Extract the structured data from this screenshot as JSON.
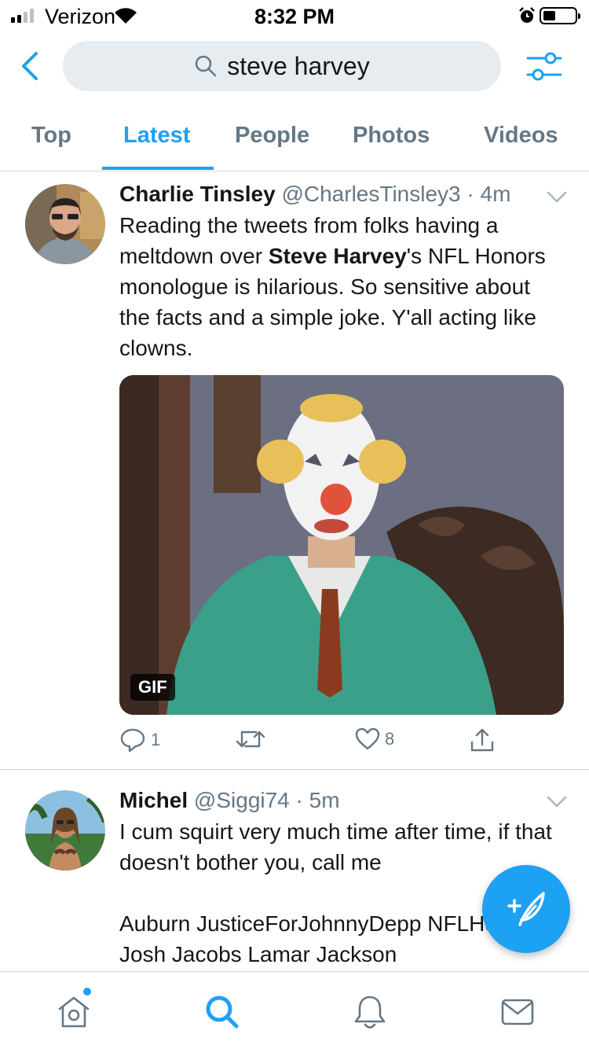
{
  "status_bar": {
    "carrier": "Verizon",
    "time": "8:32 PM",
    "signal_bars": 4,
    "signal_bars_active": 2
  },
  "header": {
    "back_icon": "chevron-left-icon",
    "search_query": "steve harvey",
    "filter_icon": "sliders-icon"
  },
  "tabs": [
    {
      "label": "Top",
      "active": false
    },
    {
      "label": "Latest",
      "active": true
    },
    {
      "label": "People",
      "active": false
    },
    {
      "label": "Photos",
      "active": false
    },
    {
      "label": "Videos",
      "active": false
    }
  ],
  "tweets": [
    {
      "name": "Charlie Tinsley",
      "handle": "@CharlesTinsley3",
      "time": "4m",
      "text_before": "Reading the tweets from folks having a meltdown over ",
      "text_bold": "Steve Harvey",
      "text_after": "'s NFL Honors monologue is hilarious. So sensitive about the facts and a simple joke. Y'all acting like clowns.",
      "media_badge": "GIF",
      "reply_count": "1",
      "retweet_count": "",
      "like_count": "8"
    },
    {
      "name": "Michel",
      "handle": "@Siggi74",
      "time": "5m",
      "text": "I cum squirt very much time after time, if that doesn't bother you, call me\n\nAuburn JusticeForJohnnyDepp NFLHonors Josh Jacobs Lamar Jackson"
    }
  ],
  "colors": {
    "accent": "#1da1f2",
    "text_primary": "#14171a",
    "text_secondary": "#657786",
    "search_bg": "#e6ecf0",
    "divider": "#d4d8dc"
  },
  "bottom_nav": [
    {
      "icon": "home-icon",
      "has_dot": true,
      "active": false
    },
    {
      "icon": "search-icon",
      "active": true
    },
    {
      "icon": "bell-icon",
      "active": false
    },
    {
      "icon": "mail-icon",
      "active": false
    }
  ],
  "fab": {
    "icon": "compose-tweet-icon"
  }
}
